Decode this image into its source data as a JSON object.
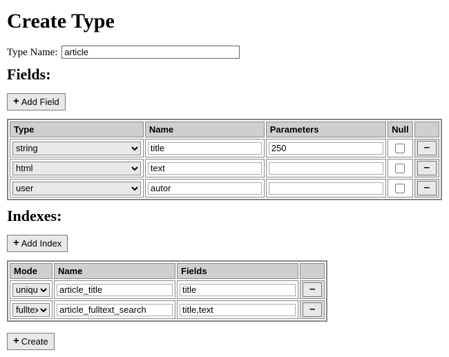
{
  "page_title": "Create Type",
  "type_name": {
    "label": "Type Name:",
    "value": "article"
  },
  "fields_section": {
    "heading": "Fields:",
    "add_button_label": "Add Field",
    "columns": {
      "type": "Type",
      "name": "Name",
      "parameters": "Parameters",
      "null": "Null"
    },
    "rows": [
      {
        "type": "string",
        "name": "title",
        "parameters": "250",
        "null": false
      },
      {
        "type": "html",
        "name": "text",
        "parameters": "",
        "null": false
      },
      {
        "type": "user",
        "name": "autor",
        "parameters": "",
        "null": false
      }
    ]
  },
  "indexes_section": {
    "heading": "Indexes:",
    "add_button_label": "Add Index",
    "columns": {
      "mode": "Mode",
      "name": "Name",
      "fields": "Fields"
    },
    "rows": [
      {
        "mode": "unique",
        "name": "article_title",
        "fields": "title"
      },
      {
        "mode": "fulltext",
        "name": "article_fulltext_search",
        "fields": "title,text"
      }
    ]
  },
  "create_button_label": "Create",
  "icons": {
    "plus": "+",
    "minus": "–"
  }
}
